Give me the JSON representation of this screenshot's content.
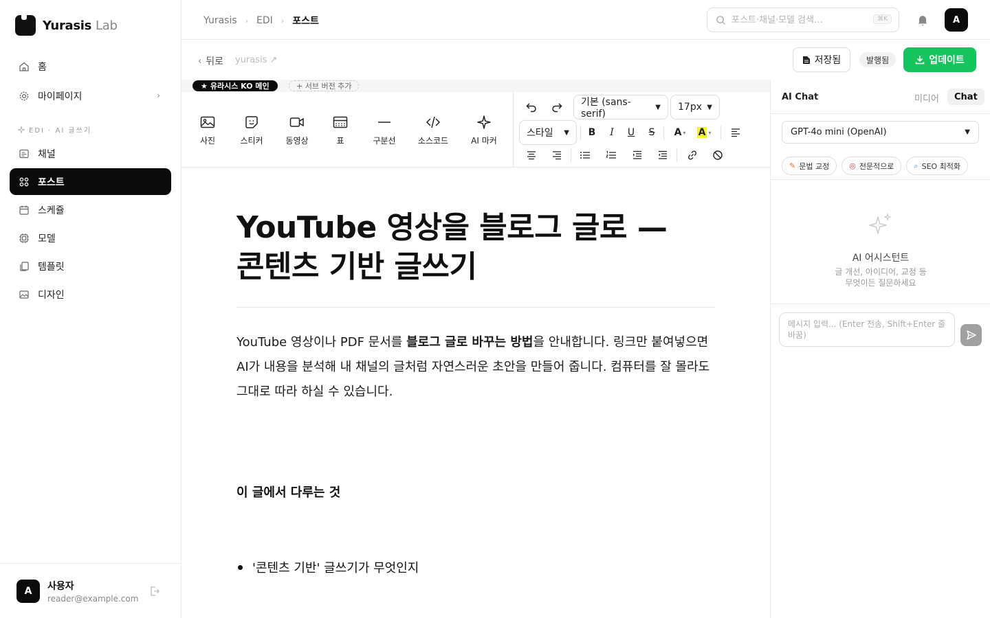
{
  "brand": {
    "name": "Yurasis",
    "suffix": "Lab"
  },
  "sidebar": {
    "items_top": [
      {
        "label": "홈",
        "icon": "home-icon"
      },
      {
        "label": "마이페이지",
        "icon": "gear-icon"
      }
    ],
    "section_label": "EDI · AI 글쓰기",
    "items": [
      {
        "label": "채널",
        "icon": "channel-icon"
      },
      {
        "label": "포스트",
        "icon": "grid-icon",
        "active": true
      },
      {
        "label": "스케쥴",
        "icon": "calendar-icon"
      },
      {
        "label": "모델",
        "icon": "chip-icon"
      },
      {
        "label": "템플릿",
        "icon": "copy-icon"
      },
      {
        "label": "디자인",
        "icon": "image-icon"
      }
    ],
    "user": {
      "initial": "A",
      "name": "사용자",
      "email": "reader@example.com"
    }
  },
  "header": {
    "breadcrumb": [
      "Yurasis",
      "EDI",
      "포스트"
    ],
    "search_placeholder": "포스트·채널·모델 검색…",
    "search_shortcut": "⌘K",
    "avatar_initial": "A"
  },
  "actionbar": {
    "back_label": "뒤로",
    "slug": "yurasis ↗",
    "saved_label": "저장됨",
    "status_badge": "발행됨",
    "update_label": "업데이트"
  },
  "versions": {
    "main_label": "유라시스 KO 메인",
    "add_label": "+ 서브 버전 추가"
  },
  "toolbar": {
    "insert": [
      {
        "label": "사진",
        "icon": "photo-icon"
      },
      {
        "label": "스티커",
        "icon": "sticker-icon"
      },
      {
        "label": "동영상",
        "icon": "video-icon"
      },
      {
        "label": "표",
        "icon": "table-icon"
      },
      {
        "label": "구분선",
        "icon": "divider-icon"
      },
      {
        "label": "소스코드",
        "icon": "code-icon"
      },
      {
        "label": "AI 마커",
        "icon": "sparkle-icon"
      }
    ],
    "font_family": "기본 (sans-serif)",
    "font_size": "17px",
    "style_label": "스타일",
    "bold": "B",
    "italic": "I",
    "underline": "U",
    "strike": "S",
    "text_color": "A",
    "highlight": "A"
  },
  "document": {
    "title_line1": "YouTube 영상을 블로그 글로 —",
    "title_line2": "콘텐츠 기반 글쓰기",
    "intro_before": "YouTube 영상이나 PDF 문서를 ",
    "intro_bold": "블로그 글로 바꾸는 방법",
    "intro_after": "을 안내합니다. 링크만 붙여넣으면 AI가 내용을 분석해 내 채널의 글처럼 자연스러운 초안을 만들어 줍니다. 컴퓨터를 잘 몰라도 그대로 따라 하실 수 있습니다.",
    "heading": "이 글에서 다루는 것",
    "bullet1": "'콘텐츠 기반' 글쓰기가 무엇인지"
  },
  "panel": {
    "title": "AI Chat",
    "tab_media": "미디어",
    "tab_chat": "Chat",
    "model": "GPT-4o mini (OpenAI)",
    "quick_actions": [
      {
        "label": "문법 교정",
        "icon": "pencil-icon"
      },
      {
        "label": "전문적으로",
        "icon": "target-icon"
      },
      {
        "label": "SEO 최적화",
        "icon": "magnifier-icon"
      }
    ],
    "assistant_title": "AI 어시스턴트",
    "assistant_sub_line1": "글 개선, 아이디어, 교정 등",
    "assistant_sub_line2": "무엇이든 질문하세요",
    "message_placeholder": "메시지 입력... (Enter 전송, Shift+Enter 줄바꿈)"
  },
  "colors": {
    "accent_green": "#16c45d",
    "active_dark": "#0b0b0c",
    "highlight_yellow": "#f7f32a"
  }
}
